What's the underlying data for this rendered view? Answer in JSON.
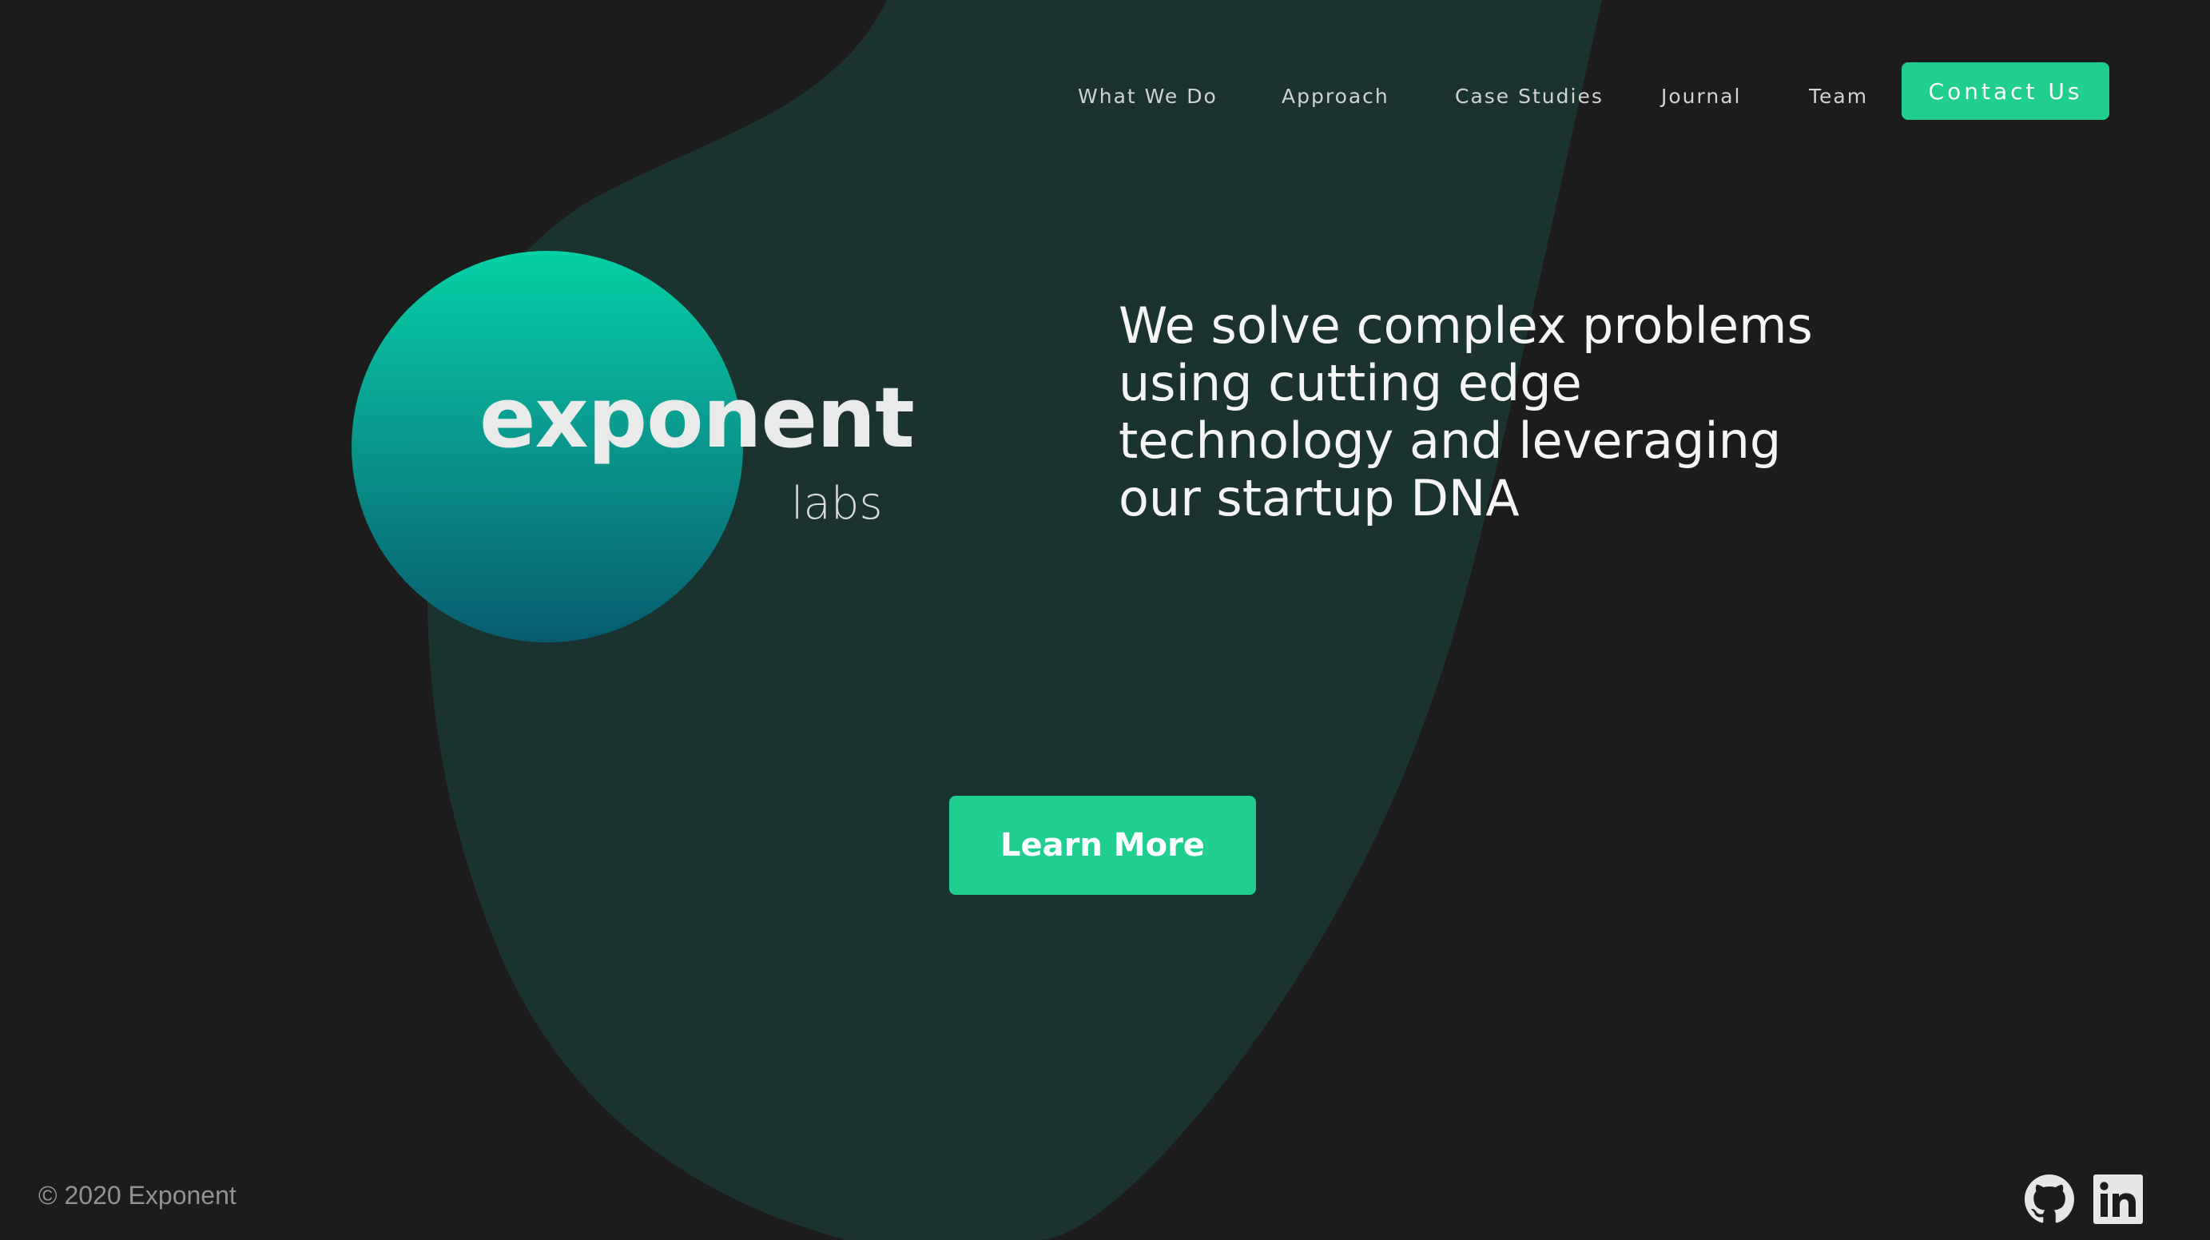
{
  "nav": {
    "items": [
      {
        "label": "What We Do"
      },
      {
        "label": "Approach"
      },
      {
        "label": "Case Studies"
      },
      {
        "label": "Journal"
      },
      {
        "label": "Team"
      }
    ],
    "contact_label": "Contact Us"
  },
  "logo": {
    "word": "exponent",
    "sub": "labs"
  },
  "hero": {
    "tagline_lines": [
      "We solve complex problems",
      "using cutting edge",
      "technology and leveraging",
      "our startup DNA"
    ],
    "cta_label": "Learn More"
  },
  "footer": {
    "copyright": "© 2020 Exponent",
    "social": [
      {
        "icon": "github-icon"
      },
      {
        "icon": "linkedin-icon"
      }
    ]
  },
  "colors": {
    "background": "#1c1c1c",
    "blob": "#1b3330",
    "accent": "#20cf8f",
    "circle_top": "#05d0a6",
    "circle_bottom": "#075c6e"
  }
}
